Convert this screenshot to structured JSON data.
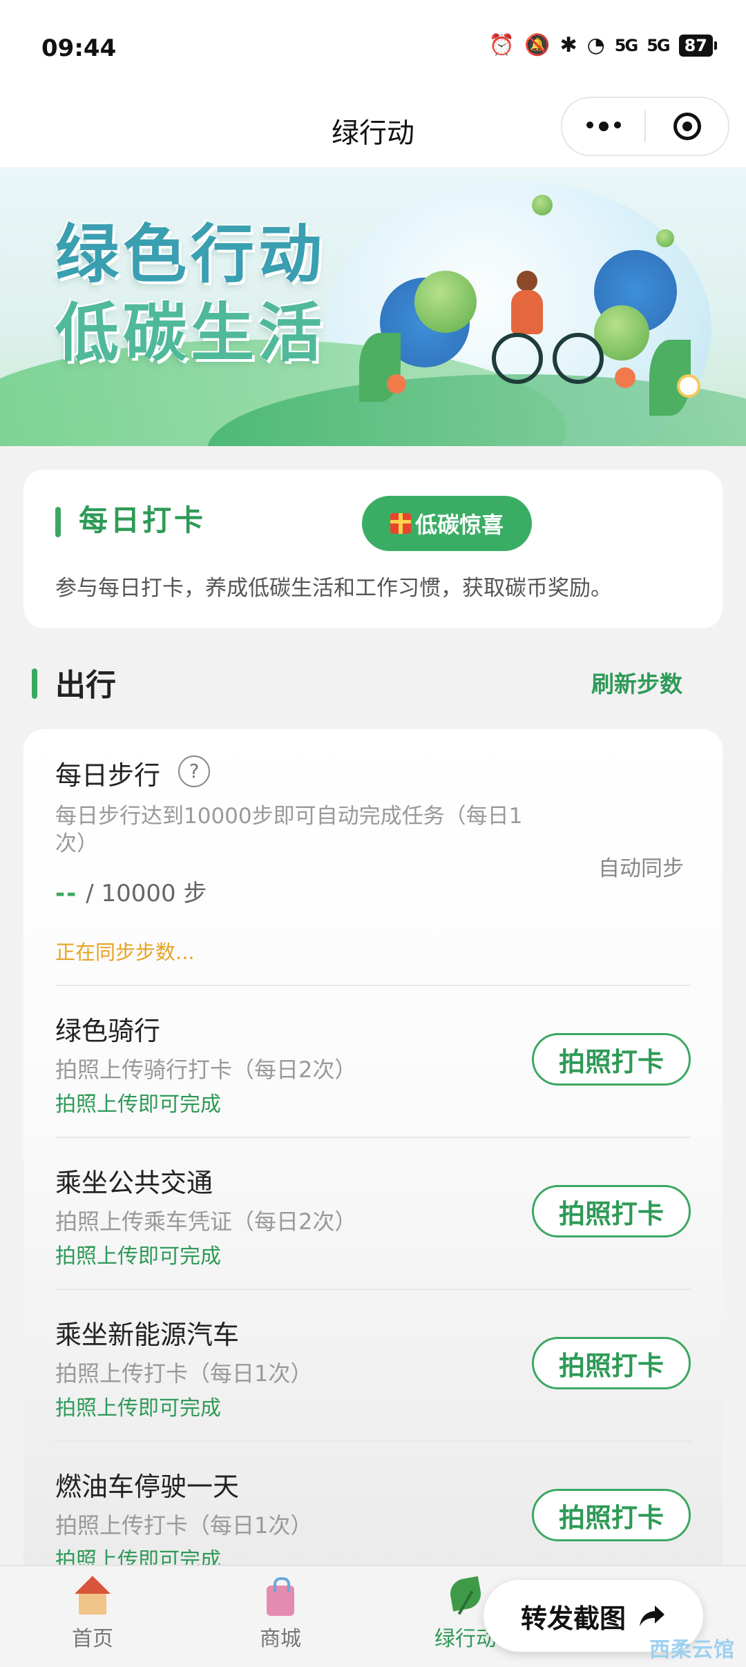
{
  "status_bar": {
    "time": "09:44",
    "signal1": "5G",
    "signal2": "5G",
    "battery": "87"
  },
  "nav": {
    "title": "绿行动"
  },
  "banner": {
    "line1": "绿色行动",
    "line2": "低碳生活"
  },
  "daily_checkin": {
    "title": "每日打卡",
    "surprise_label": "低碳惊喜",
    "description": "参与每日打卡，养成低碳生活和工作习惯，获取碳币奖励。"
  },
  "travel": {
    "title": "出行",
    "refresh_label": "刷新步数"
  },
  "steps": {
    "title": "每日步行",
    "help": "?",
    "description": "每日步行达到10000步即可自动完成任务（每日1次）",
    "current": "--",
    "target": "/ 10000 步",
    "syncing": "正在同步步数...",
    "auto_sync": "自动同步"
  },
  "tasks": [
    {
      "name": "绿色骑行",
      "desc": "拍照上传骑行打卡（每日2次）",
      "hint": "拍照上传即可完成",
      "button": "拍照打卡"
    },
    {
      "name": "乘坐公共交通",
      "desc": "拍照上传乘车凭证（每日2次）",
      "hint": "拍照上传即可完成",
      "button": "拍照打卡"
    },
    {
      "name": "乘坐新能源汽车",
      "desc": "拍照上传打卡（每日1次）",
      "hint": "拍照上传即可完成",
      "button": "拍照打卡"
    },
    {
      "name": "燃油车停驶一天",
      "desc": "拍照上传打卡（每日1次）",
      "hint": "拍照上传即可完成",
      "button": "拍照打卡"
    }
  ],
  "tabbar": {
    "home": "首页",
    "shop": "商城",
    "green": "绿行动"
  },
  "share": {
    "label": "转发截图"
  },
  "watermark": "西柔云馆",
  "colors": {
    "accent": "#3aa860",
    "accent_text": "#2e9a57",
    "warning": "#e6a324"
  },
  "icons": [
    "alarm-icon",
    "mute-icon",
    "bluetooth-icon",
    "wifi-icon",
    "more-icon",
    "close-miniprogram-icon",
    "gift-icon",
    "help-icon",
    "home-icon",
    "shop-icon",
    "leaf-icon",
    "share-icon"
  ]
}
